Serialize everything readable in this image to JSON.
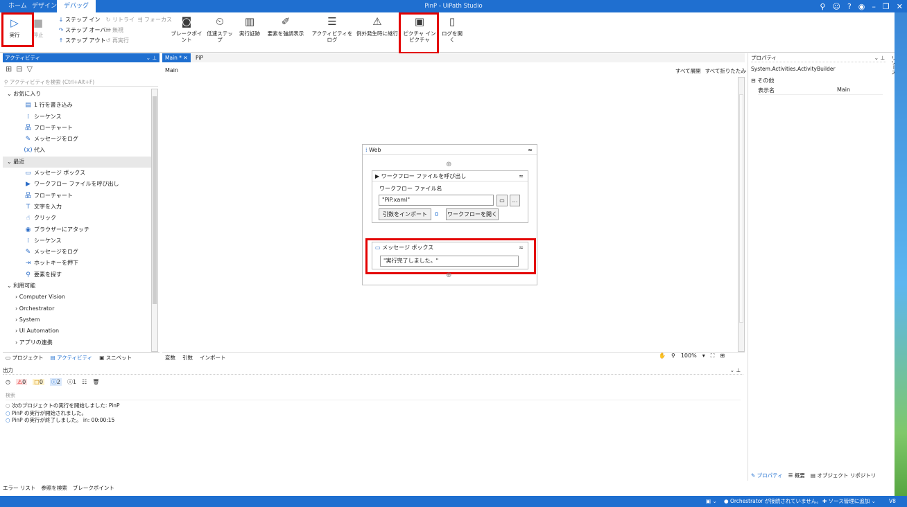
{
  "window": {
    "title": "PinP - UiPath Studio",
    "menu_tabs": [
      "ホーム",
      "デザイン",
      "デバッグ"
    ]
  },
  "ribbon": {
    "run": "実行",
    "stop": "停止",
    "step_into": "ステップ イン",
    "step_over": "ステップ オーバー",
    "step_out": "ステップ アウト",
    "retry": "リトライ",
    "focus": "フォーカス",
    "ignore": "無視",
    "rerun": "再実行",
    "breakpoint": "ブレークポイント",
    "slow_step": "低速ステップ",
    "execution_trail": "実行証跡",
    "highlight": "要素を強調表示",
    "log_activity": "アクティビティをログ",
    "continue_on_exception": "例外発生時に継行",
    "pip": "ピクチャ イン ピクチャ",
    "open_logs": "ログを開く"
  },
  "activities": {
    "panel_title": "アクティビティ",
    "search_placeholder": "アクティビティを検索 (Ctrl+Alt+F)",
    "favorites_label": "お気に入り",
    "favorites": [
      {
        "icon": "write-line-icon",
        "glyph": "▤",
        "label": "1 行を書き込み"
      },
      {
        "icon": "sequence-icon",
        "glyph": "⁞",
        "label": "シーケンス"
      },
      {
        "icon": "flowchart-icon",
        "glyph": "品",
        "label": "フローチャート"
      },
      {
        "icon": "log-message-icon",
        "glyph": "✎",
        "label": "メッセージをログ"
      },
      {
        "icon": "assign-icon",
        "glyph": "(x)",
        "label": "代入"
      }
    ],
    "recent_label": "最近",
    "recent": [
      {
        "icon": "message-box-icon",
        "glyph": "▭",
        "label": "メッセージ ボックス"
      },
      {
        "icon": "invoke-workflow-icon",
        "glyph": "▶",
        "label": "ワークフロー ファイルを呼び出し"
      },
      {
        "icon": "flowchart-icon",
        "glyph": "品",
        "label": "フローチャート"
      },
      {
        "icon": "type-into-icon",
        "glyph": "T",
        "label": "文字を入力"
      },
      {
        "icon": "click-icon",
        "glyph": "☝",
        "label": "クリック"
      },
      {
        "icon": "attach-browser-icon",
        "glyph": "◉",
        "label": "ブラウザーにアタッチ"
      },
      {
        "icon": "sequence-icon",
        "glyph": "⁞",
        "label": "シーケンス"
      },
      {
        "icon": "log-message-icon",
        "glyph": "✎",
        "label": "メッセージをログ"
      },
      {
        "icon": "send-hotkey-icon",
        "glyph": "⇥",
        "label": "ホットキーを押下"
      },
      {
        "icon": "find-element-icon",
        "glyph": "⚲",
        "label": "要素を探す"
      }
    ],
    "available_label": "利用可能",
    "available": [
      "Computer Vision",
      "Orchestrator",
      "System",
      "UI Automation",
      "アプリの連携"
    ],
    "bottom_tabs": [
      "プロジェクト",
      "アクティビティ",
      "スニペット"
    ]
  },
  "designer": {
    "tabs": [
      "Main *",
      "PiP"
    ],
    "breadcrumb": "Main",
    "expand_all": "すべて展開",
    "collapse_all": "すべて折りたたみ",
    "sequence_title": "Web",
    "invoke_title": "ワークフロー ファイルを呼び出し",
    "workflow_file_label": "ワークフロー ファイル名",
    "workflow_file_value": "\"PiP.xaml\"",
    "import_args": "引数をインポート",
    "args_count": "0",
    "open_workflow": "ワークフローを開く",
    "msgbox_title": "メッセージ ボックス",
    "msgbox_value": "\"実行完了しました。\"",
    "bottom_tabs": [
      "変数",
      "引数",
      "インポート"
    ],
    "zoom": "100%"
  },
  "properties": {
    "panel_title": "プロパティ",
    "type": "System.Activities.ActivityBuilder",
    "section": "その他",
    "display_name_label": "表示名",
    "display_name_value": "Main",
    "bottom_tabs": [
      "プロパティ",
      "概要",
      "オブジェクト リポジトリ"
    ],
    "side_label": "リソース"
  },
  "output": {
    "title": "出力",
    "counts": [
      "0",
      "0",
      "2",
      "1"
    ],
    "search_label": "検索",
    "lines": [
      "次のプロジェクトの実行を開始しました: PinP",
      "PinP の実行が開始されました。",
      "PinP の実行が終了しました。 in: 00:00:15"
    ]
  },
  "bottom_tabs": [
    "エラー リスト",
    "参照を検索",
    "ブレークポイント"
  ],
  "status": {
    "orchestrator": "Orchestrator が接続されていません。",
    "source_control": "ソース管理に追加",
    "version": "V8"
  },
  "colors": {
    "accent": "#1f6fd0",
    "highlight": "#e30000"
  }
}
